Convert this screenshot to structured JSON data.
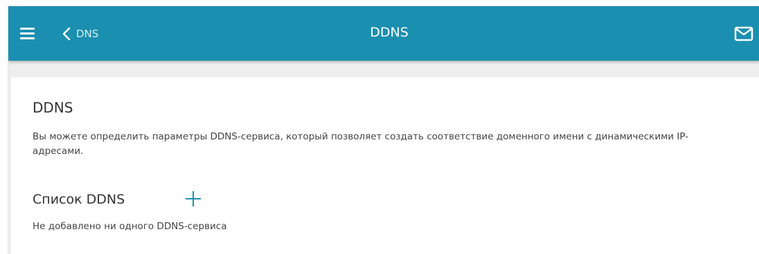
{
  "header": {
    "back_label": "DNS",
    "title": "DDNS"
  },
  "content": {
    "heading": "DDNS",
    "description": "Вы можете определить параметры DDNS-сервиса, который позволяет создать соответствие доменного имени с динамическими IP-адресами.",
    "list_title": "Список DDNS",
    "empty_message": "Не добавлено ни одного DDNS-сервиса"
  },
  "icons": {
    "menu": "hamburger-menu-icon",
    "back": "chevron-left-icon",
    "mail": "envelope-icon",
    "add": "plus-icon"
  },
  "colors": {
    "accent": "#1b8fb0",
    "header_text": "#ffffff",
    "body_text": "#444444",
    "page_background": "#eeeeee"
  }
}
